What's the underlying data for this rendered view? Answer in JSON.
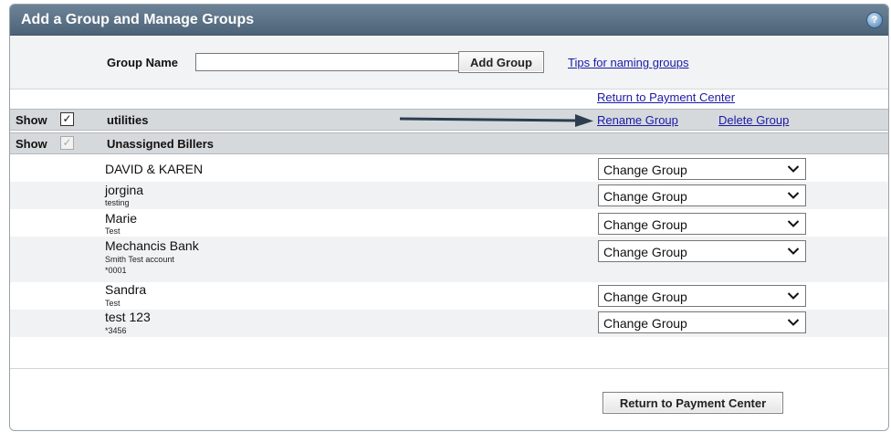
{
  "window": {
    "title": "Add a Group and Manage Groups",
    "help_glyph": "?"
  },
  "group_form": {
    "label": "Group Name",
    "input_value": "",
    "add_button": "Add Group",
    "tips_link": "Tips for naming groups"
  },
  "return_link": "Return to Payment Center",
  "groups": [
    {
      "show_label": "Show",
      "checked": true,
      "name": "utilities",
      "rename_link": "Rename Group",
      "delete_link": "Delete Group"
    },
    {
      "show_label": "Show",
      "checked": true,
      "disabled": true,
      "name": "Unassigned Billers"
    }
  ],
  "billers": [
    {
      "name": "DAVID & KAREN",
      "details": [],
      "action": "Change Group"
    },
    {
      "name": "jorgina",
      "details": [
        "testing"
      ],
      "action": "Change Group"
    },
    {
      "name": "Marie",
      "details": [
        "Test"
      ],
      "action": "Change Group"
    },
    {
      "name": "Mechancis Bank",
      "details": [
        "Smith Test account",
        "*0001"
      ],
      "action": "Change Group"
    },
    {
      "name": "Sandra",
      "details": [
        "Test"
      ],
      "action": "Change Group"
    },
    {
      "name": "test 123",
      "details": [
        "*3456"
      ],
      "action": "Change Group"
    }
  ],
  "return_button": "Return to Payment Center",
  "colors": {
    "titlebar": "#5a7085",
    "link": "#1a1aa6",
    "group_row": "#d6d9dc",
    "arrow": "#2c3e50"
  },
  "icons": {
    "help": "help-icon",
    "checkbox": "checkmark-icon",
    "dropdown": "chevron-down-icon",
    "pointer": "arrow-right-icon"
  }
}
